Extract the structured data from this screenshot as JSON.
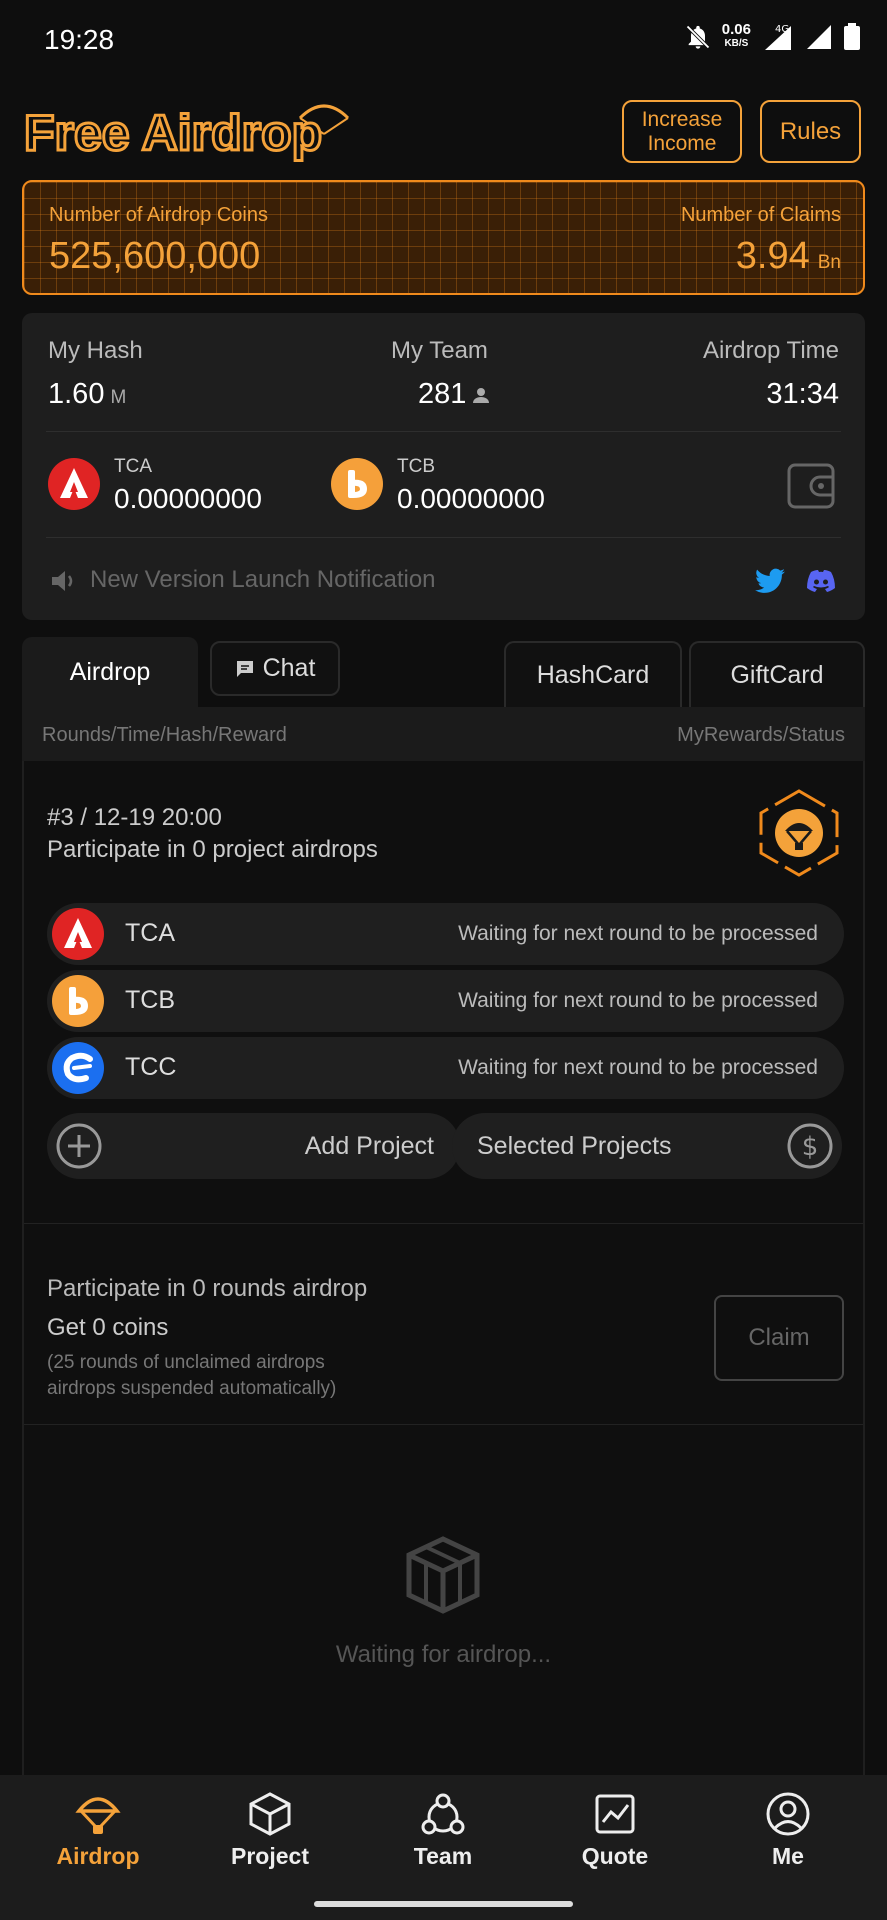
{
  "status_bar": {
    "time": "19:28",
    "net_speed": "0.06",
    "net_unit": "KB/S",
    "net_type": "4G"
  },
  "header": {
    "logo_text": "Free Airdrop",
    "increase_income_label": "Increase Income",
    "rules_label": "Rules"
  },
  "coins_panel": {
    "airdrop_coins_label": "Number of Airdrop Coins",
    "airdrop_coins_value": "525,600,000",
    "claims_label": "Number of Claims",
    "claims_value": "3.94",
    "claims_unit": "Bn"
  },
  "stats": {
    "my_hash_label": "My Hash",
    "my_hash_value": "1.60",
    "my_hash_unit": "M",
    "my_team_label": "My Team",
    "my_team_value": "281",
    "airdrop_time_label": "Airdrop Time",
    "airdrop_time_value": "31:34"
  },
  "balances": [
    {
      "symbol": "TCA",
      "amount": "0.00000000",
      "color": "#e02424"
    },
    {
      "symbol": "TCB",
      "amount": "0.00000000",
      "color": "#f5a03a"
    }
  ],
  "notice": {
    "text": "New Version Launch Notification"
  },
  "tabs": {
    "airdrop": "Airdrop",
    "chat": "Chat",
    "hashcard": "HashCard",
    "giftcard": "GiftCard"
  },
  "subheader": {
    "left": "Rounds/Time/Hash/Reward",
    "right": "MyRewards/Status"
  },
  "round": {
    "title": "#3 / 12-19 20:00",
    "subtitle": "Participate in 0 project airdrops"
  },
  "projects": [
    {
      "symbol": "TCA",
      "status": "Waiting for next round to be processed",
      "color": "#e02424"
    },
    {
      "symbol": "TCB",
      "status": "Waiting for next round to be processed",
      "color": "#f5a03a"
    },
    {
      "symbol": "TCC",
      "status": "Waiting for next round to be processed",
      "color": "#1b6ff0"
    }
  ],
  "actions": {
    "add_project": "Add Project",
    "selected_projects": "Selected Projects"
  },
  "summary": {
    "rounds": "Participate in 0 rounds airdrop",
    "coins": "Get 0 coins",
    "note_line1": "(25 rounds of unclaimed airdrops",
    "note_line2": "airdrops suspended automatically)",
    "claim_label": "Claim"
  },
  "empty": {
    "text": "Waiting for airdrop..."
  },
  "nav": {
    "airdrop": "Airdrop",
    "project": "Project",
    "team": "Team",
    "quote": "Quote",
    "me": "Me"
  },
  "colors": {
    "accent": "#f4a23a",
    "background": "#0e0e0e",
    "card": "#1e1e1e",
    "twitter": "#1d9bf0",
    "discord": "#5865f2"
  }
}
